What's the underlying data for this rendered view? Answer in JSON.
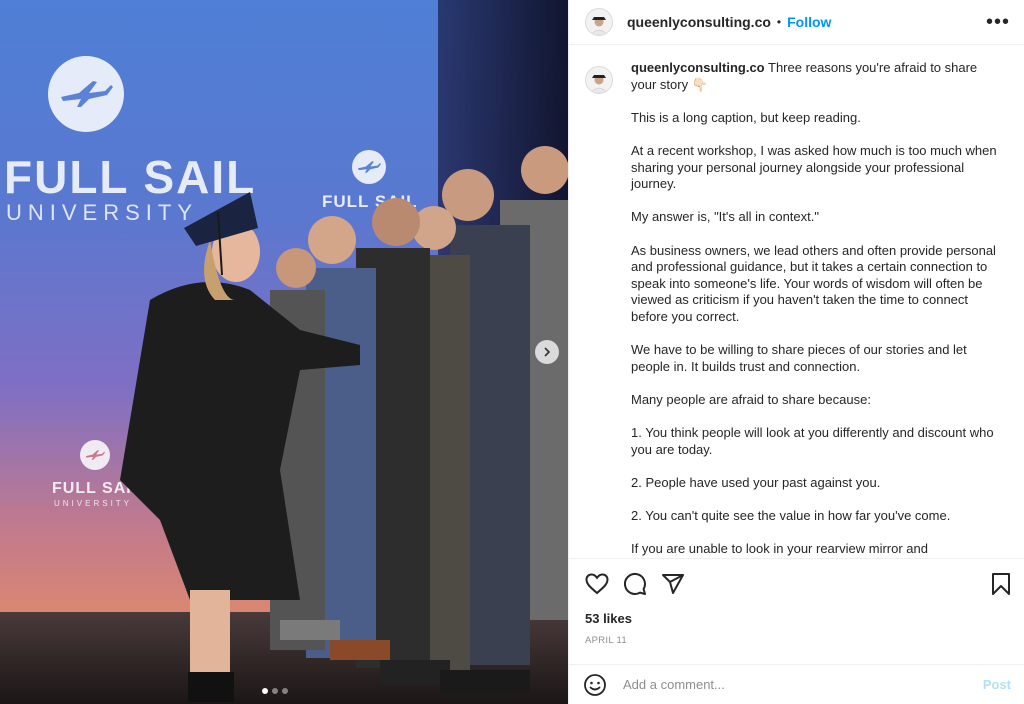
{
  "media": {
    "brand_text": "FULL SAIL",
    "brand_sub": "UNIVERSITY",
    "brand_text_small": "FULL SAIL",
    "brand_sub_small": "UNIVERSITY",
    "carousel_count": 3,
    "carousel_active": 1
  },
  "header": {
    "username": "queenlyconsulting.co",
    "separator": "•",
    "follow_label": "Follow",
    "more_label": "•••"
  },
  "caption": {
    "username": "queenlyconsulting.co",
    "first_line": "Three reasons you're afraid to share your story 👇🏻",
    "paragraphs": [
      "This is a long caption, but keep reading.",
      "At a recent workshop, I was asked how much is too much when sharing your personal journey alongside your professional journey.",
      "My answer is, \"It's all in context.\"",
      "As business owners, we lead others and often provide personal and professional guidance, but it takes a certain connection to speak into someone's life. Your words of wisdom will often be viewed as criticism if you haven't taken the time to connect before you correct.",
      "We have to be willing to share pieces of our stories and let people in. It builds trust and connection.",
      "Many people are afraid to share because:",
      "1. You think people will look at you differently and discount who you are today.",
      "2. People have used your past against you.",
      "2. You can't quite see the value in how far you've come.",
      "If you are unable to look in your rearview mirror and"
    ]
  },
  "actions": {
    "likes": "53 likes",
    "date": "APRIL 11"
  },
  "comment_box": {
    "placeholder": "Add a comment...",
    "post_label": "Post"
  }
}
